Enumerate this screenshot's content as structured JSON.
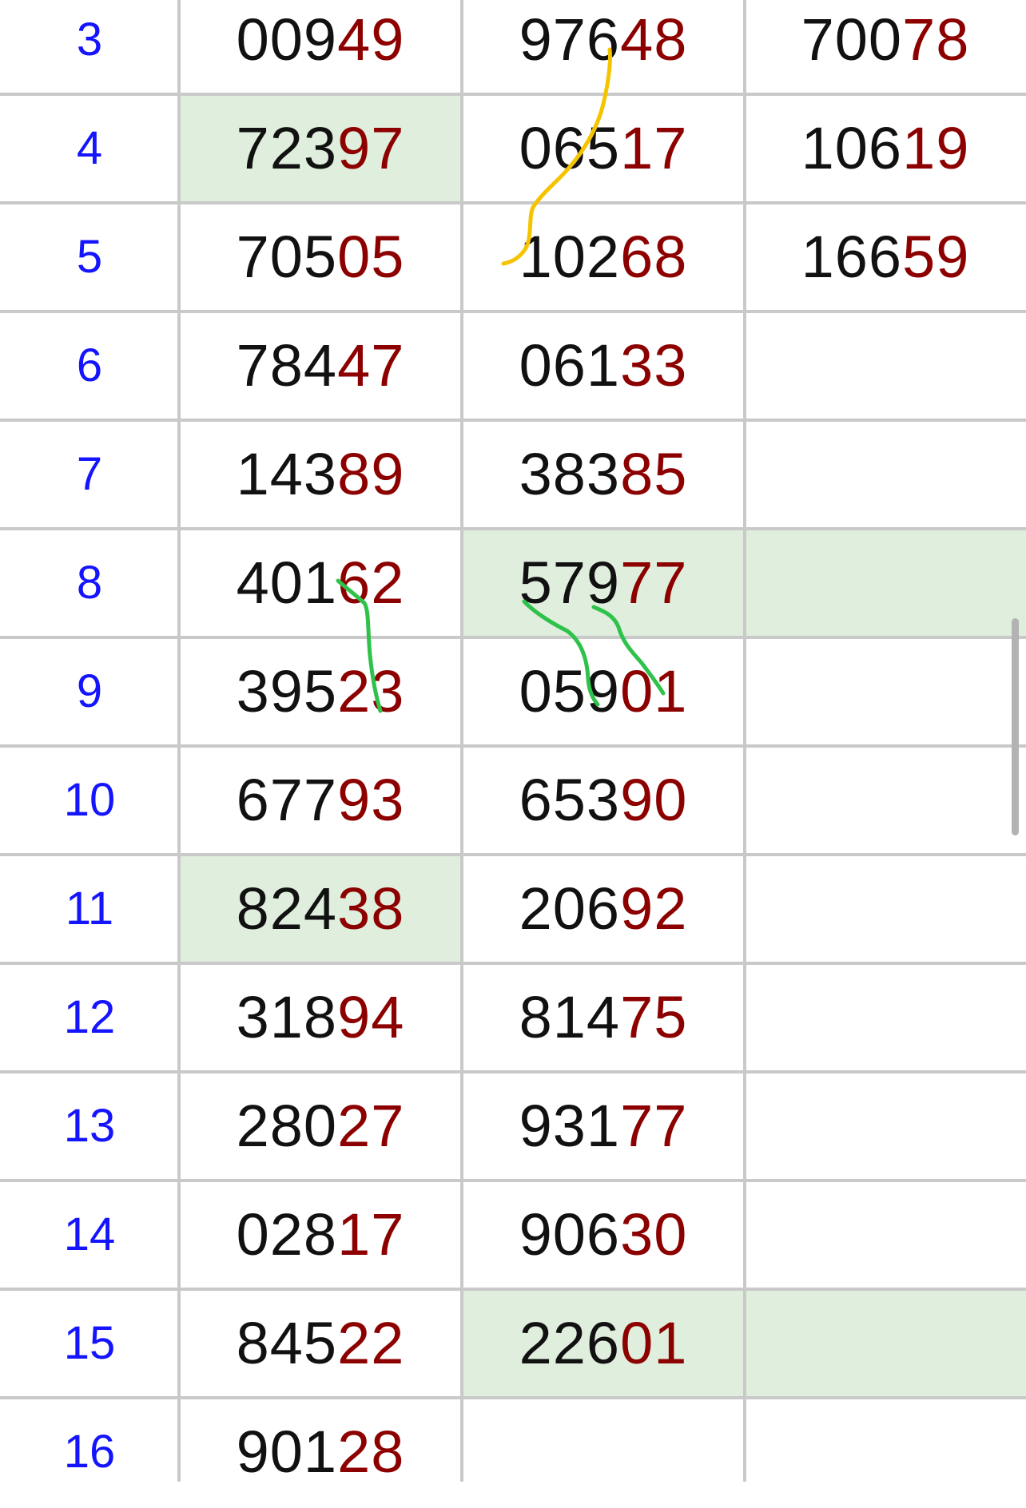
{
  "rows": [
    {
      "idx": "3",
      "c1": {
        "p": "009",
        "s": "49"
      },
      "c2": {
        "p": "976",
        "s": "48"
      },
      "c3": {
        "p": "700",
        "s": "78"
      }
    },
    {
      "idx": "4",
      "c1": {
        "p": "723",
        "s": "97"
      },
      "c2": {
        "p": "065",
        "s": "17"
      },
      "c3": {
        "p": "106",
        "s": "19"
      }
    },
    {
      "idx": "5",
      "c1": {
        "p": "705",
        "s": "05"
      },
      "c2": {
        "p": "102",
        "s": "68"
      },
      "c3": {
        "p": "166",
        "s": "59"
      }
    },
    {
      "idx": "6",
      "c1": {
        "p": "784",
        "s": "47"
      },
      "c2": {
        "p": "061",
        "s": "33"
      },
      "c3": {
        "p": "",
        "s": ""
      }
    },
    {
      "idx": "7",
      "c1": {
        "p": "143",
        "s": "89"
      },
      "c2": {
        "p": "383",
        "s": "85"
      },
      "c3": {
        "p": "",
        "s": ""
      }
    },
    {
      "idx": "8",
      "c1": {
        "p": "401",
        "s": "62"
      },
      "c2": {
        "p": "579",
        "s": "77"
      },
      "c3": {
        "p": "",
        "s": ""
      }
    },
    {
      "idx": "9",
      "c1": {
        "p": "395",
        "s": "23"
      },
      "c2": {
        "p": "059",
        "s": "01"
      },
      "c3": {
        "p": "",
        "s": ""
      }
    },
    {
      "idx": "10",
      "c1": {
        "p": "677",
        "s": "93"
      },
      "c2": {
        "p": "653",
        "s": "90"
      },
      "c3": {
        "p": "",
        "s": ""
      }
    },
    {
      "idx": "11",
      "c1": {
        "p": "824",
        "s": "38"
      },
      "c2": {
        "p": "206",
        "s": "92"
      },
      "c3": {
        "p": "",
        "s": ""
      }
    },
    {
      "idx": "12",
      "c1": {
        "p": "318",
        "s": "94"
      },
      "c2": {
        "p": "814",
        "s": "75"
      },
      "c3": {
        "p": "",
        "s": ""
      }
    },
    {
      "idx": "13",
      "c1": {
        "p": "280",
        "s": "27"
      },
      "c2": {
        "p": "931",
        "s": "77"
      },
      "c3": {
        "p": "",
        "s": ""
      }
    },
    {
      "idx": "14",
      "c1": {
        "p": "028",
        "s": "17"
      },
      "c2": {
        "p": "906",
        "s": "30"
      },
      "c3": {
        "p": "",
        "s": ""
      }
    },
    {
      "idx": "15",
      "c1": {
        "p": "845",
        "s": "22"
      },
      "c2": {
        "p": "226",
        "s": "01"
      },
      "c3": {
        "p": "",
        "s": ""
      }
    },
    {
      "idx": "16",
      "c1": {
        "p": "901",
        "s": "28"
      },
      "c2": {
        "p": "",
        "s": ""
      },
      "c3": {
        "p": "",
        "s": ""
      }
    }
  ],
  "highlighted_cells": [
    "1.c1",
    "5.c2",
    "5.c3",
    "8.c1",
    "12.c2",
    "12.c3"
  ],
  "colors": {
    "index_text": "#1414ff",
    "number_prefix": "#111111",
    "number_suffix": "#8c0000",
    "highlight_bg": "#dfeedd",
    "grid_line": "#c9c9c9",
    "annotation_yellow": "#f5c400",
    "annotation_green": "#2fc24a"
  }
}
